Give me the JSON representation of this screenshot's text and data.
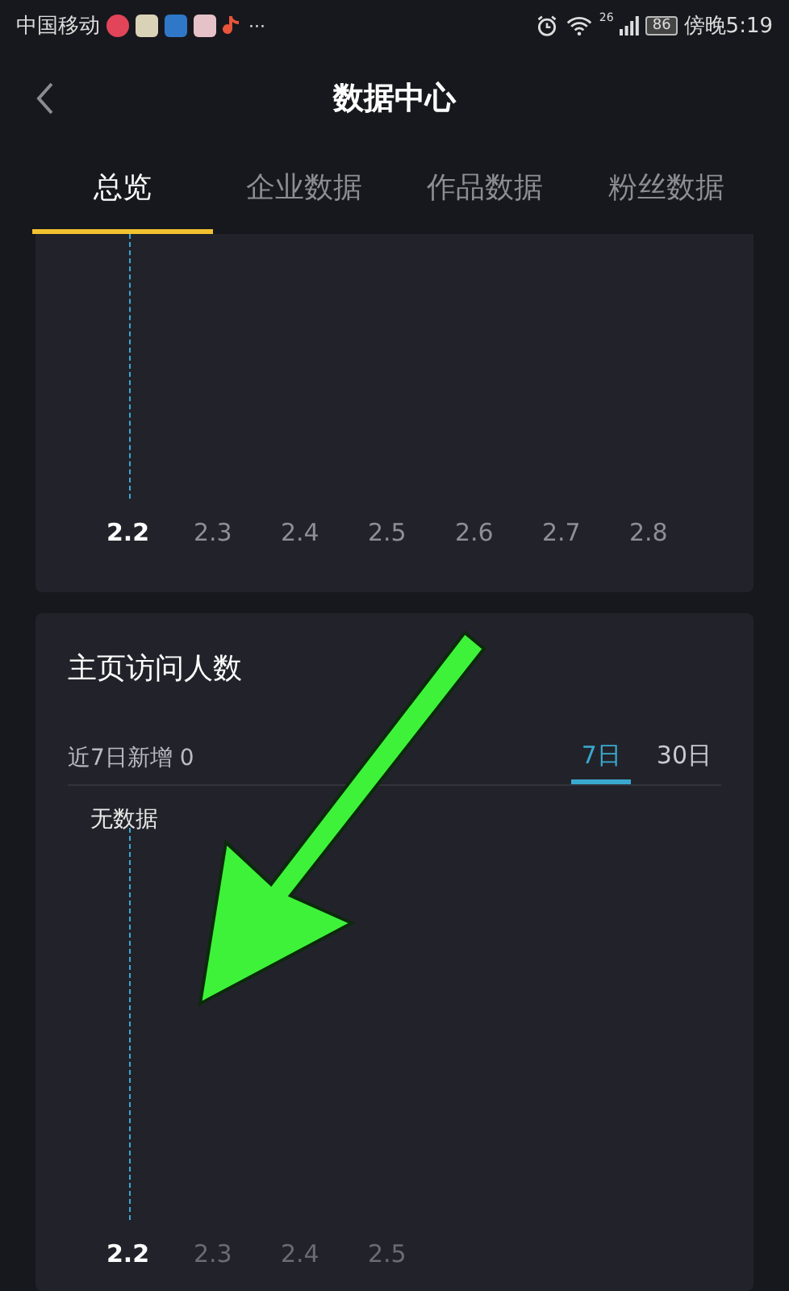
{
  "status_bar": {
    "carrier": "中国移动",
    "overflow": "···",
    "network": "26",
    "battery": "86",
    "time": "傍晚5:19"
  },
  "header": {
    "title": "数据中心"
  },
  "tabs": [
    {
      "label": "总览",
      "selected": true
    },
    {
      "label": "企业数据",
      "selected": false
    },
    {
      "label": "作品数据",
      "selected": false
    },
    {
      "label": "粉丝数据",
      "selected": false
    }
  ],
  "trend_card": {
    "dates": [
      {
        "label": "2.2",
        "selected": true
      },
      {
        "label": "2.3",
        "selected": false
      },
      {
        "label": "2.4",
        "selected": false
      },
      {
        "label": "2.5",
        "selected": false
      },
      {
        "label": "2.6",
        "selected": false
      },
      {
        "label": "2.7",
        "selected": false
      },
      {
        "label": "2.8",
        "selected": false
      }
    ]
  },
  "visitors_card": {
    "title": "主页访问人数",
    "summary": "近7日新增 0",
    "periods": [
      {
        "label": "7日",
        "selected": true
      },
      {
        "label": "30日",
        "selected": false
      }
    ],
    "empty_text": "无数据",
    "dates": [
      {
        "label": "2.2",
        "selected": true
      },
      {
        "label": "2.3",
        "selected": false
      },
      {
        "label": "2.4",
        "selected": false
      },
      {
        "label": "2.5",
        "selected": false
      }
    ]
  }
}
